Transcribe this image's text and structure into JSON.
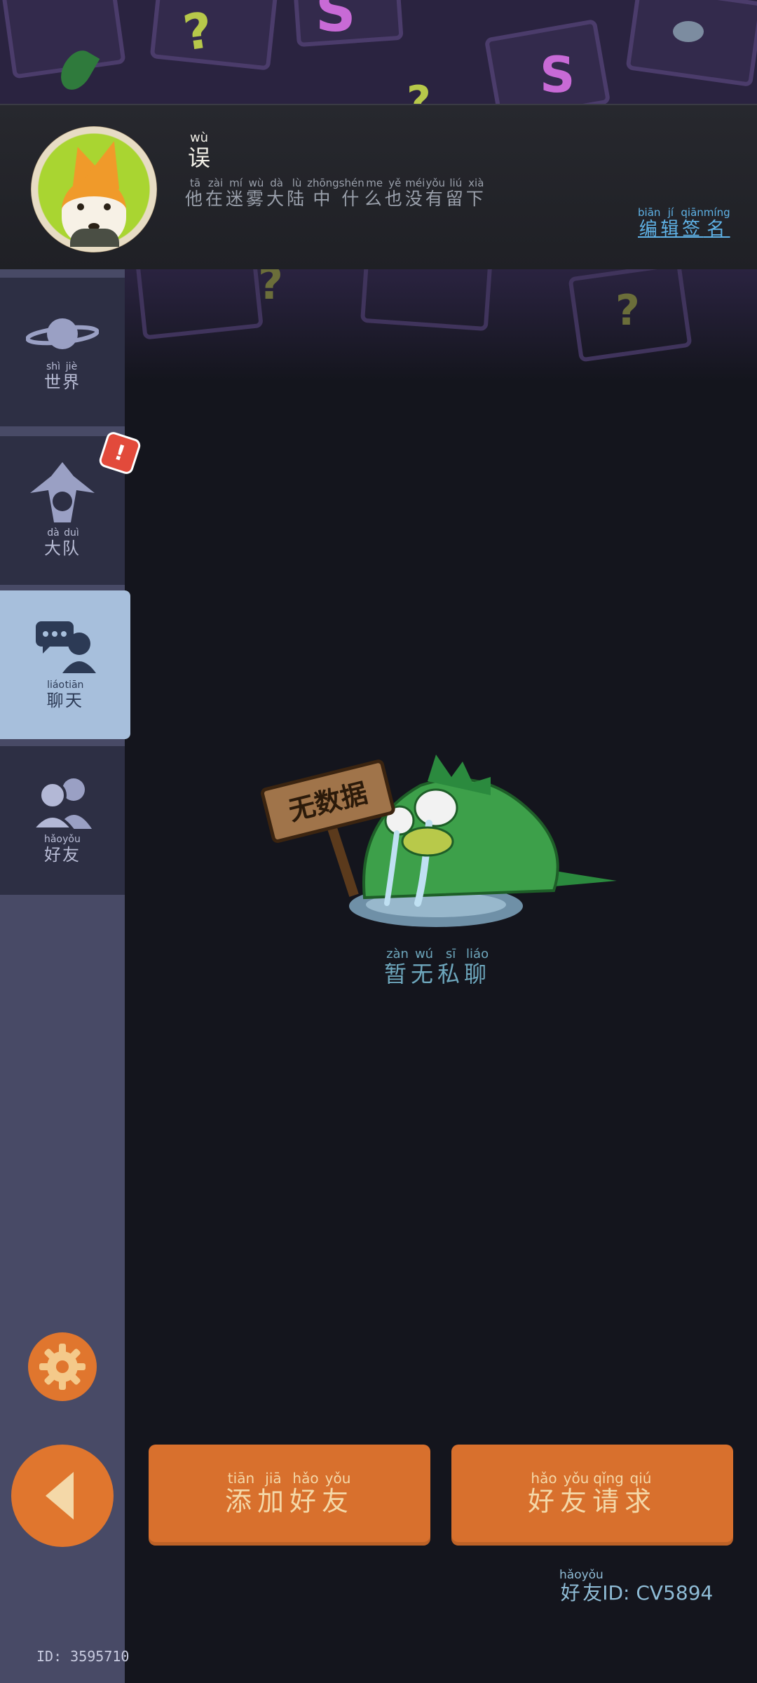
{
  "profile": {
    "name": "误",
    "name_pinyin": "wù",
    "signature_chars": [
      "他",
      "在",
      "迷",
      "雾",
      "大",
      "陆",
      "中",
      "什",
      "么",
      "也",
      "没",
      "有",
      "留",
      "下"
    ],
    "signature_pinyin": [
      "tā",
      "zài",
      "mí",
      "wù",
      "dà",
      "lù",
      "zhōng",
      "shén",
      "me",
      "yě",
      "méi",
      "yǒu",
      "liú",
      "xià"
    ],
    "edit_signature": {
      "chars": [
        "编",
        "辑",
        "签",
        "名"
      ],
      "pinyin": [
        "biān",
        "jí",
        "qiān",
        "míng"
      ]
    }
  },
  "sidebar": {
    "items": [
      {
        "chars": [
          "世",
          "界"
        ],
        "pinyin": [
          "shì",
          "jiè"
        ],
        "icon": "planet-icon"
      },
      {
        "chars": [
          "大",
          "队"
        ],
        "pinyin": [
          "dà",
          "duì"
        ],
        "icon": "team-icon"
      },
      {
        "chars": [
          "聊",
          "天"
        ],
        "pinyin": [
          "liáo",
          "tiān"
        ],
        "icon": "chat-icon"
      },
      {
        "chars": [
          "好",
          "友"
        ],
        "pinyin": [
          "hǎo",
          "yǒu"
        ],
        "icon": "friends-icon"
      }
    ],
    "badge": "!",
    "user_id": "ID: 3595710"
  },
  "main": {
    "sign_text": "无数据",
    "empty": {
      "chars": [
        "暂",
        "无",
        "私",
        "聊"
      ],
      "pinyin": [
        "zàn",
        "wú",
        "sī",
        "liáo"
      ]
    },
    "add_friend": {
      "chars": [
        "添",
        "加",
        "好",
        "友"
      ],
      "pinyin": [
        "tiān",
        "jiā",
        "hǎo",
        "yǒu"
      ]
    },
    "friend_requests": {
      "chars": [
        "好",
        "友",
        "请",
        "求"
      ],
      "pinyin": [
        "hǎo",
        "yǒu",
        "qǐng",
        "qiú"
      ]
    },
    "friend_id": {
      "chars": [
        "好",
        "友"
      ],
      "pinyin": [
        "hǎo",
        "yǒu"
      ],
      "value": "ID: CV5894"
    }
  },
  "colors": {
    "accent": "#d8702d",
    "active_tab": "#a7bfdc",
    "link": "#5fb2e6",
    "alert": "#e24a3b"
  }
}
